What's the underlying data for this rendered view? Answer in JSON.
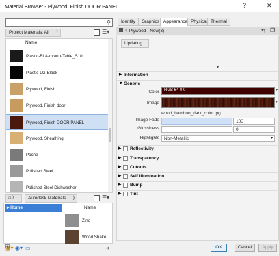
{
  "window": {
    "title": "Material Browser - Plywood, Finish DOOR PANEL",
    "help_label": "?",
    "close_label": "✕"
  },
  "search": {
    "value": "",
    "placeholder": "",
    "icon": "search-icon"
  },
  "library_filter": {
    "label": "Project Materials: All"
  },
  "materials": {
    "header": "Name",
    "items": [
      {
        "label": "Plastic-BLA-qvarto-Table_S10",
        "swatch": "#1a1a1a"
      },
      {
        "label": "Plastic-LG-Black",
        "swatch": "#050505"
      },
      {
        "label": "Plywood, Finish",
        "swatch": "#c9a067"
      },
      {
        "label": "Plywood, Finish door",
        "swatch": "#c79a5e"
      },
      {
        "label": "Plywood, Finish DOOR PANEL",
        "swatch": "#4a180c",
        "selected": true
      },
      {
        "label": "Plywood, Sheathing",
        "swatch": "#d8b074"
      },
      {
        "label": "Poche",
        "swatch": "#7a7a7a"
      },
      {
        "label": "Polished Steel",
        "swatch": "#9a9a9a"
      },
      {
        "label": "Polished Steel Dishwasher",
        "swatch": "#b5b5b5"
      }
    ]
  },
  "library_nav": {
    "breadcrumb": "Autodesk Materials"
  },
  "library_tree": {
    "items": [
      "Home"
    ]
  },
  "library_assets": {
    "header": "Name",
    "items": [
      {
        "label": "Zinc",
        "swatch": "#8e8e8e"
      },
      {
        "label": "Wood Shake",
        "swatch": "#5b4331"
      }
    ]
  },
  "tabs": [
    {
      "label": "Identity"
    },
    {
      "label": "Graphics"
    },
    {
      "label": "Appearance",
      "active": true
    },
    {
      "label": "Physical"
    },
    {
      "label": "Thermal"
    }
  ],
  "asset": {
    "name": "Plywood - New(3)"
  },
  "editor": {
    "updating_label": "Updating...",
    "sections": {
      "information": "Information",
      "generic": "Generic",
      "reflectivity": "Reflectivity",
      "transparency": "Transparency",
      "cutouts": "Cutouts",
      "self_illumination": "Self Illumination",
      "bump": "Bump",
      "tint": "Tint"
    },
    "props": {
      "color_label": "Color",
      "color_value": "RGB 64 0 0",
      "image_label": "Image",
      "image_file": "wood_bamboo_dark_color.jpg",
      "image_fade_label": "Image Fade",
      "image_fade_value": "100",
      "image_fade_fraction": 1.0,
      "glossiness_label": "Glossiness",
      "glossiness_value": "0",
      "highlights_label": "Highlights",
      "highlights_value": "Non-Metallic"
    }
  },
  "buttons": {
    "ok": "OK",
    "cancel": "Cancel",
    "apply": "Apply"
  },
  "colors": {
    "selection": "#cfe0f5",
    "accent": "#3a7fd5",
    "color_swatch": "#400000"
  }
}
